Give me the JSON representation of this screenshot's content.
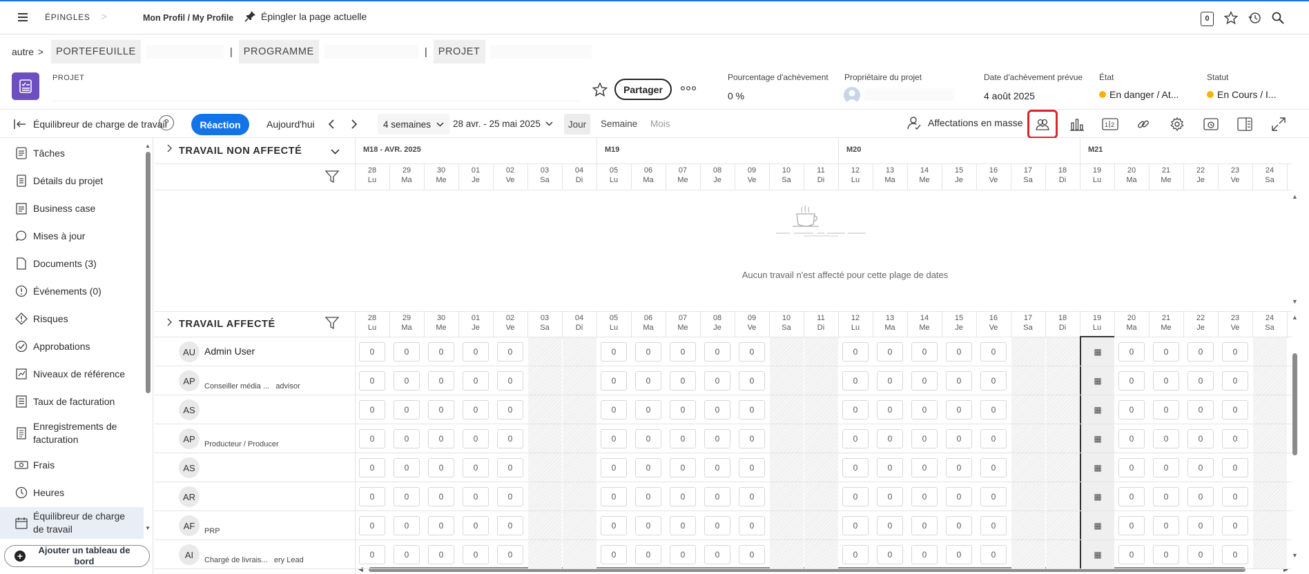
{
  "topbar": {
    "pins_label": "ÉPINGLES",
    "profile_link": "Mon Profil / My Profile",
    "pin_page_label": "Épingler la page actuelle",
    "notifications_count": "0"
  },
  "breadcrumb": {
    "root": "autre",
    "separator": ">",
    "portfolio": "PORTEFEUILLE",
    "program": "PROGRAMME",
    "project": "PROJET",
    "pipe": "|"
  },
  "project": {
    "type_label": "PROJET",
    "share_button": "Partager",
    "completion_label": "Pourcentage d'achèvement",
    "completion_value": "0 %",
    "owner_label": "Propriétaire du projet",
    "due_label": "Date d'achèvement prévue",
    "due_value": "4 août 2025",
    "state_label": "État",
    "state_value": "En danger / At...",
    "status_label": "Statut",
    "status_value": "En Cours / I...",
    "status_color": "#f5b400"
  },
  "toolbar": {
    "title": "Équilibreur de charge de travail",
    "reaction_button": "Réaction",
    "today_button": "Aujourd'hui",
    "range_select": "4 semaines",
    "date_range": "28 avr. - 25 mai 2025",
    "view_day": "Jour",
    "view_week": "Semaine",
    "view_month": "Mois",
    "bulk_assign": "Affectations en masse",
    "accent_color": "#1473e6",
    "highlight_color": "#d7262d"
  },
  "sidebar": {
    "items": [
      {
        "label": "Tâches",
        "icon": "checklist-icon"
      },
      {
        "label": "Détails du projet",
        "icon": "document-icon"
      },
      {
        "label": "Business case",
        "icon": "briefcase-icon"
      },
      {
        "label": "Mises à jour",
        "icon": "chat-bubble-icon"
      },
      {
        "label": "Documents (3)",
        "icon": "file-icon"
      },
      {
        "label": "Événements (0)",
        "icon": "event-icon"
      },
      {
        "label": "Risques",
        "icon": "risk-diamond-icon"
      },
      {
        "label": "Approbations",
        "icon": "check-circle-icon"
      },
      {
        "label": "Niveaux de référence",
        "icon": "baseline-icon"
      },
      {
        "label": "Taux de facturation",
        "icon": "rate-icon"
      },
      {
        "label": "Enregistrements de facturation",
        "icon": "billing-icon"
      },
      {
        "label": "Frais",
        "icon": "money-icon"
      },
      {
        "label": "Heures",
        "icon": "clock-icon"
      },
      {
        "label": "Équilibreur de charge de travail",
        "icon": "calendar-icon"
      }
    ],
    "add_dashboard": "Ajouter un tableau de bord"
  },
  "grid": {
    "unassigned_title": "TRAVAIL NON AFFECTÉ",
    "assigned_title": "TRAVAIL AFFECTÉ",
    "empty_message": "Aucun travail n'est affecté pour cette plage de dates",
    "weeks": [
      "M18 - AVR. 2025",
      "M19",
      "M20",
      "M21"
    ],
    "days": [
      {
        "d": "28",
        "w": "Lu"
      },
      {
        "d": "29",
        "w": "Ma"
      },
      {
        "d": "30",
        "w": "Me"
      },
      {
        "d": "01",
        "w": "Je"
      },
      {
        "d": "02",
        "w": "Ve"
      },
      {
        "d": "03",
        "w": "Sa"
      },
      {
        "d": "04",
        "w": "Di"
      },
      {
        "d": "05",
        "w": "Lu"
      },
      {
        "d": "06",
        "w": "Ma"
      },
      {
        "d": "07",
        "w": "Me"
      },
      {
        "d": "08",
        "w": "Je"
      },
      {
        "d": "09",
        "w": "Ve"
      },
      {
        "d": "10",
        "w": "Sa"
      },
      {
        "d": "11",
        "w": "Di"
      },
      {
        "d": "12",
        "w": "Lu"
      },
      {
        "d": "13",
        "w": "Ma"
      },
      {
        "d": "14",
        "w": "Me"
      },
      {
        "d": "15",
        "w": "Je"
      },
      {
        "d": "16",
        "w": "Ve"
      },
      {
        "d": "17",
        "w": "Sa"
      },
      {
        "d": "18",
        "w": "Di"
      },
      {
        "d": "19",
        "w": "Lu"
      },
      {
        "d": "20",
        "w": "Ma"
      },
      {
        "d": "21",
        "w": "Me"
      },
      {
        "d": "22",
        "w": "Je"
      },
      {
        "d": "23",
        "w": "Ve"
      },
      {
        "d": "24",
        "w": "Sa"
      }
    ],
    "users": [
      {
        "initials": "AU",
        "name": "Admin User",
        "role": ""
      },
      {
        "initials": "AP",
        "name": "",
        "role": "Conseiller média ...   advisor"
      },
      {
        "initials": "AS",
        "name": "",
        "role": ""
      },
      {
        "initials": "AP",
        "name": "",
        "role": "Producteur / Producer"
      },
      {
        "initials": "AS",
        "name": "",
        "role": ""
      },
      {
        "initials": "AR",
        "name": "",
        "role": ""
      },
      {
        "initials": "AF",
        "name": "",
        "role": "PRP"
      },
      {
        "initials": "AI",
        "name": "",
        "role": "Chargé de livrais...   ery Lead"
      }
    ],
    "cell_value": "0"
  }
}
